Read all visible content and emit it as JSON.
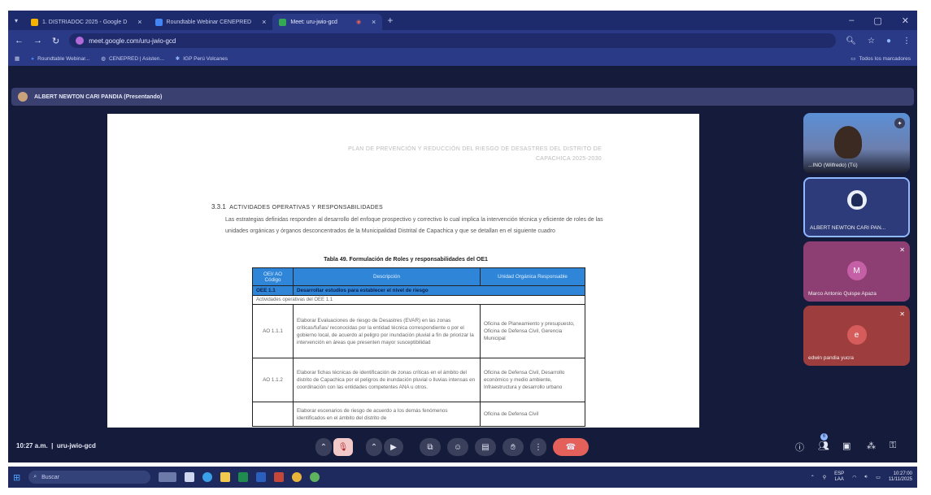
{
  "browser": {
    "tabs": [
      {
        "label": "1. DISTRIADOC 2025 - Google D",
        "color": "#f4b400"
      },
      {
        "label": "Roundtable Webinar CENEPRED",
        "color": "#4285f4"
      },
      {
        "label": "Meet: uru-jwio-gcd",
        "color": "#34a853"
      }
    ],
    "new_tab_label": "+",
    "url": "meet.google.com/uru-jwio-gcd",
    "bookmarks": [
      "Roundtable Webinar...",
      "CENEPRED | Asisten...",
      "IGP Perú Volcanes"
    ],
    "all_bookmarks_label": "Todos los marcadores"
  },
  "meet": {
    "presenter_label": "ALBERT NEWTON CARI PANDIA (Presentando)",
    "meeting_time": "10:27 a.m.",
    "meeting_code": "uru-jwio-gcd",
    "participants": [
      {
        "name": "...INO (Wilfredo) (Tú)",
        "type": "video"
      },
      {
        "name": "ALBERT NEWTON CARI PAN...",
        "type": "avatar"
      },
      {
        "name": "Marco Antonio Quispe Apaza",
        "initial": "M",
        "color": "#a94c8e"
      },
      {
        "name": "edwin pandia yucra",
        "initial": "e",
        "color": "#c04a4a"
      }
    ],
    "people_count": "6"
  },
  "document": {
    "header_lines": [
      "PLAN DE PREVENCIÓN Y REDUCCIÓN DEL RIESGO DE DESASTRES DEL DISTRITO DE",
      "CAPACHICA 2025-2030"
    ],
    "section_number": "3.3.1",
    "section_title": "ACTIVIDADES OPERATIVAS Y RESPONSABILIDADES",
    "section_body": "Las estrategias definidas responden al desarrollo del enfoque prospectivo y correctivo lo cual implica la intervención técnica y eficiente de roles de las unidades orgánicas y órganos desconcentrados de la Municipalidad Distrital de Capachica y que se detallan en el siguiente cuadro",
    "table_caption": "Tabla 49. Formulación de Roles y responsabilidades del OE1",
    "table_headers": [
      "OEI/ AO Código",
      "Descripción",
      "Unidad Orgánica Responsable"
    ],
    "oe_row": {
      "code": "OEE 1.1",
      "desc": "Desarrollar estudios para establecer el nivel de riesgo"
    },
    "sub_row": "Actividades operativas del OEE 1.1",
    "rows": [
      {
        "code": "AO 1.1.1",
        "desc": "Elaborar Evaluaciones de riesgo de Desastres (EVAR) en las zonas críticas/fuñas/ reconocidas por la entidad técnica correspondiente o por el gobierno local, de acuerdo al peligro por inundación pluvial a fin de priorizar la intervención en áreas que presenten mayor susceptibilidad",
        "unit": "Oficina de Planeamiento y presupuesto, Oficina de Defensa Civil, Gerencia Municipal"
      },
      {
        "code": "AO 1.1.2",
        "desc": "Elaborar fichas técnicas de identificación de zonas críticas en el ámbito del distrito de Capachica por el peligros de inundación pluvial o lluvias intensas en coordinación con las entidades competentes ANA u otros.",
        "unit": "Oficina de Defensa Civil, Desarrollo económico y medio ambiente, Infraestructura y desarrollo urbano"
      },
      {
        "code": "",
        "desc": "Elaborar escenarios de riesgo de acuerdo a los demás fenómenos identificados en el ámbito del distrito de",
        "unit": "Oficina de Defensa Civil"
      }
    ]
  },
  "taskbar": {
    "search_placeholder": "Buscar",
    "lang_top": "ESP",
    "lang_bottom": "LAA",
    "time": "10:27:00",
    "date": "11/11/2025"
  }
}
